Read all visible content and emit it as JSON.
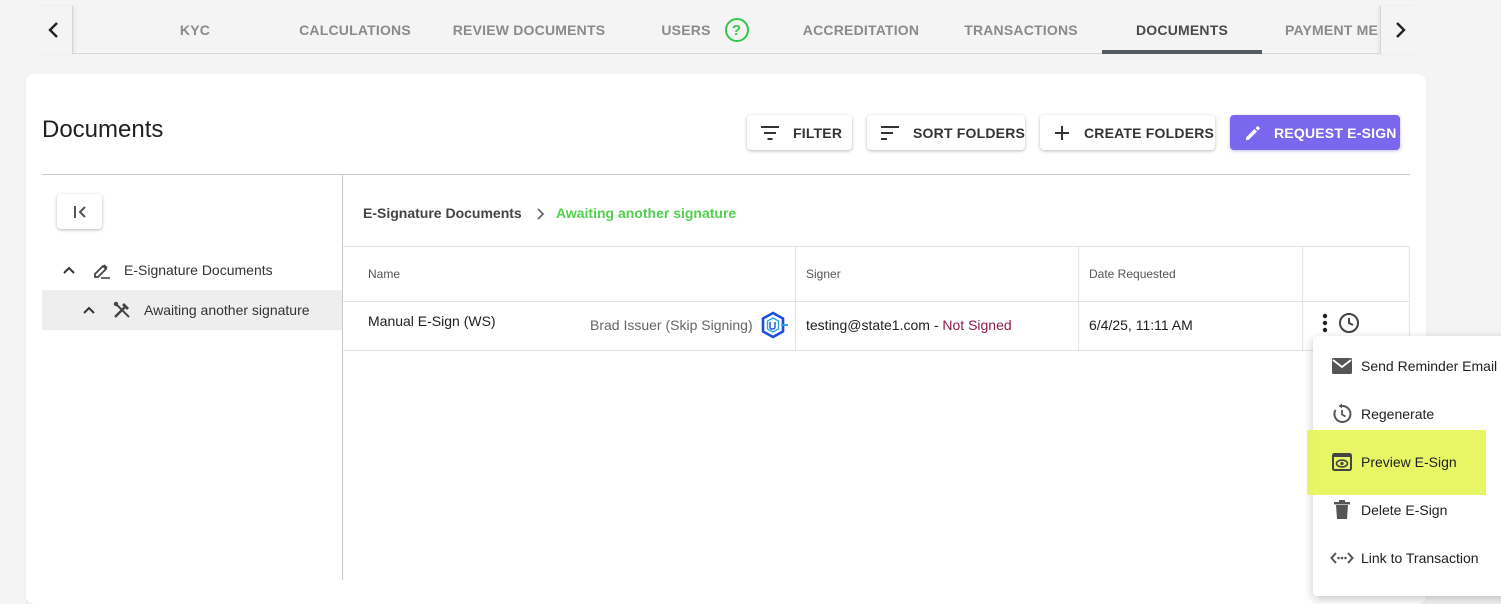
{
  "tabs": {
    "items": [
      {
        "label": "KYC"
      },
      {
        "label": "CALCULATIONS"
      },
      {
        "label": "REVIEW DOCUMENTS"
      },
      {
        "label": "USERS"
      },
      {
        "label": "ACCREDITATION"
      },
      {
        "label": "TRANSACTIONS"
      },
      {
        "label": "DOCUMENTS"
      },
      {
        "label": "PAYMENT MET"
      }
    ],
    "active": "DOCUMENTS",
    "help_glyph": "?"
  },
  "page": {
    "title": "Documents"
  },
  "toolbar": {
    "filter_label": "FILTER",
    "sort_label": "SORT FOLDERS",
    "create_label": "CREATE FOLDERS",
    "request_label": "REQUEST E-SIGN"
  },
  "tree": {
    "root": "E-Signature Documents",
    "child": "Awaiting another signature"
  },
  "breadcrumb": {
    "root": "E-Signature Documents",
    "current": "Awaiting another signature"
  },
  "table": {
    "headers": {
      "name": "Name",
      "signer": "Signer",
      "date": "Date Requested"
    },
    "rows": [
      {
        "name": "Manual E-Sign (WS)",
        "issuer": "Brad Issuer (Skip Signing)",
        "signer_email": "testing@state1.com",
        "separator": " - ",
        "signer_status": "Not Signed",
        "date": "6/4/25, 11:11 AM"
      }
    ]
  },
  "menu": {
    "items": [
      {
        "label": "Send Reminder Email",
        "icon": "mail-icon"
      },
      {
        "label": "Regenerate",
        "icon": "regenerate-icon"
      },
      {
        "label": "Preview E-Sign",
        "icon": "preview-icon"
      },
      {
        "label": "Delete E-Sign",
        "icon": "trash-icon"
      },
      {
        "label": "Link to Transaction",
        "icon": "link-icon"
      }
    ]
  },
  "colors": {
    "accent": "#7b67ee",
    "success_green": "#34c84a",
    "not_signed": "#8b1c4a",
    "highlight": "#e5f554"
  }
}
